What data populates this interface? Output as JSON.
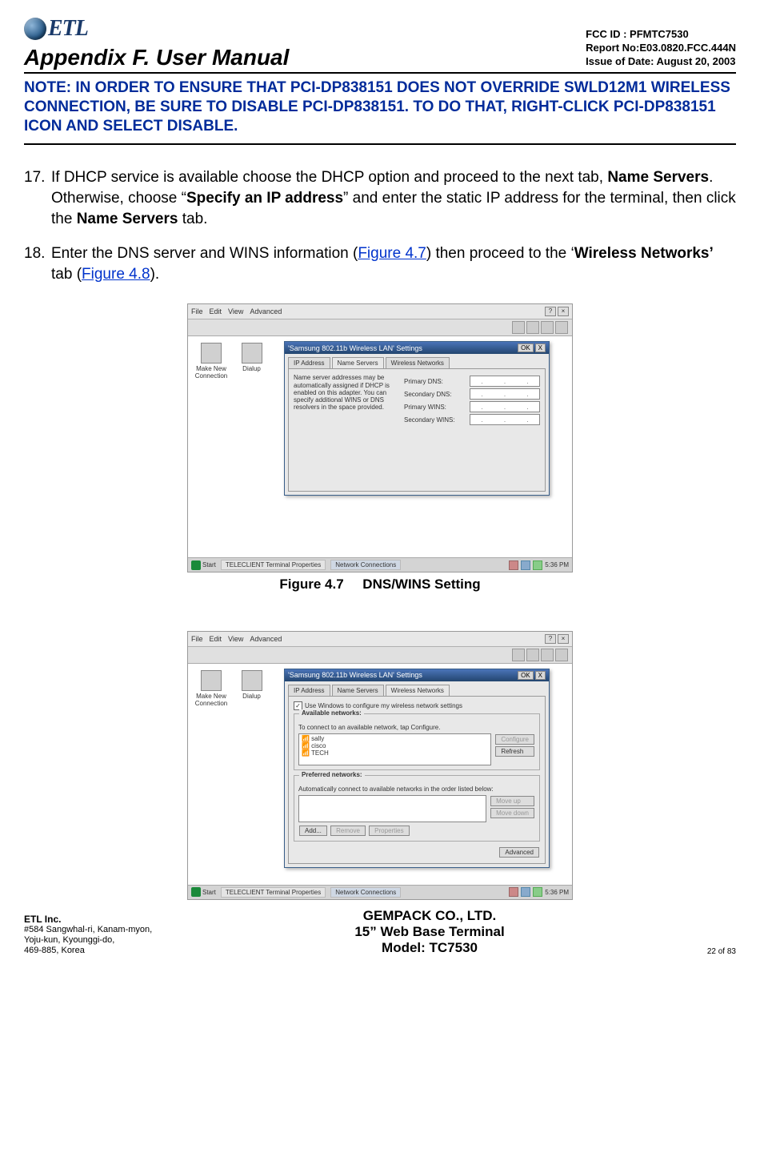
{
  "header": {
    "logo_text": "ETL",
    "appendix": "Appendix F. User Manual",
    "fcc_id": "FCC ID : PFMTC7530",
    "report_no": "Report No:E03.0820.FCC.444N",
    "issue_date": "Issue of Date: August 20, 2003"
  },
  "note": "NOTE: IN ORDER TO ENSURE THAT PCI-DP838151 DOES NOT OVERRIDE SWLD12M1 WIRELESS CONNECTION, BE SURE TO DISABLE PCI-DP838151.  TO DO THAT, RIGHT-CLICK PCI-DP838151 ICON AND SELECT DISABLE.",
  "steps": {
    "s17_pre": "If DHCP service is available choose the DHCP option and proceed to the next tab, ",
    "s17_b1": "Name Servers",
    "s17_mid1": ".  Otherwise, choose “",
    "s17_b2": "Specify an IP address",
    "s17_mid2": "” and enter the static IP address for the terminal, then click the ",
    "s17_b3": "Name Servers",
    "s17_end": " tab.",
    "s18_pre": "Enter the DNS server and WINS information (",
    "s18_link1": "Figure 4.7",
    "s18_mid1": ") then proceed to the ‘",
    "s18_b1": "Wireless Networks’",
    "s18_mid2": " tab (",
    "s18_link2": "Figure 4.8",
    "s18_end": ")."
  },
  "screenshot": {
    "menu": {
      "file": "File",
      "edit": "Edit",
      "view": "View",
      "advanced": "Advanced"
    },
    "desktop": {
      "make_new_conn": "Make New Connection",
      "dialup": "Dialup"
    },
    "dialog_title": "'Samsung 802.11b Wireless LAN' Settings",
    "ok": "OK",
    "x": "X",
    "tabs": {
      "ip": "IP Address",
      "name_servers": "Name Servers",
      "wireless": "Wireless Networks"
    },
    "dns": {
      "desc": "Name server addresses may be automatically assigned if DHCP is enabled on this adapter. You can specify additional WINS or DNS resolvers in the space provided.",
      "primary_dns": "Primary DNS:",
      "secondary_dns": "Secondary DNS:",
      "primary_wins": "Primary WINS:",
      "secondary_wins": "Secondary WINS:",
      "ip_placeholder": ". . ."
    },
    "wireless": {
      "use_windows": "Use Windows to configure my wireless network settings",
      "available_title": "Available networks:",
      "available_desc": "To connect to an available network, tap Configure.",
      "net1": "sally",
      "net2": "cisco",
      "net3": "TECH",
      "configure": "Configure",
      "refresh": "Refresh",
      "preferred_title": "Preferred networks:",
      "preferred_desc": "Automatically connect to available networks in the order listed below:",
      "move_up": "Move up",
      "move_down": "Move down",
      "add": "Add...",
      "remove": "Remove",
      "properties": "Properties",
      "advanced": "Advanced"
    },
    "taskbar": {
      "start": "Start",
      "task1": "TELECLIENT Terminal Properties",
      "task2": "Network Connections",
      "time": "5:36 PM"
    }
  },
  "figures": {
    "f47_pre": "Figure 4.7",
    "f47_title": "DNS/WINS Setting"
  },
  "footer": {
    "company": "ETL Inc.",
    "addr1": "#584 Sangwhal-ri, Kanam-myon,",
    "addr2": "Yoju-kun, Kyounggi-do,",
    "addr3": "469-885, Korea",
    "center_co": "GEMPACK CO., LTD.",
    "center_line2": "15” Web Base Terminal",
    "center_line3": "Model: TC7530",
    "page": "22 of 83"
  }
}
